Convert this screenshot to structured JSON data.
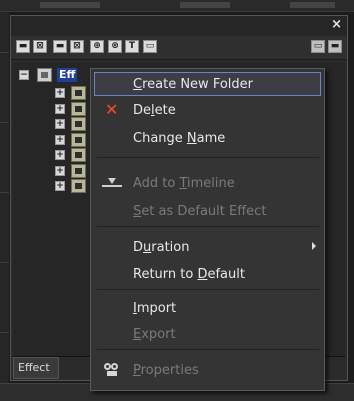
{
  "panel": {
    "close_glyph": "×",
    "toolbar_icons": [
      "new-folder-icon",
      "copy-icon",
      "paste-icon",
      "delete-icon",
      "expand-icon",
      "collapse-icon",
      "text-icon",
      "window-icon",
      "list-view-icon",
      "lock-icon"
    ],
    "toolbar_glyphs": [
      "▬",
      "⊠",
      "▬",
      "⊠",
      "⊕",
      "⊗",
      "T",
      "▭",
      "▭",
      "▬"
    ],
    "tree": {
      "root_label": "Eff",
      "expand_glyphs": {
        "collapsed": "+",
        "expanded": "−"
      },
      "child_icons": [
        "folder-icon",
        "folder-icon",
        "folder-icon",
        "folder-icon",
        "folder-icon",
        "title-folder-icon",
        "folder-icon"
      ]
    },
    "tab_label": "Effect"
  },
  "context_menu": {
    "items": [
      {
        "pre": "",
        "accel": "C",
        "post": "reate New Folder",
        "enabled": true,
        "highlighted": true,
        "icon": ""
      },
      {
        "pre": "De",
        "accel": "l",
        "post": "ete",
        "enabled": true,
        "highlighted": false,
        "icon": "delete-x-icon"
      },
      {
        "pre": "Change ",
        "accel": "N",
        "post": "ame",
        "enabled": true,
        "highlighted": false,
        "icon": ""
      },
      {
        "pre": "Add to ",
        "accel": "T",
        "post": "imeline",
        "enabled": false,
        "highlighted": false,
        "icon": "add-to-timeline-icon"
      },
      {
        "pre": "",
        "accel": "S",
        "post": "et as Default Effect",
        "enabled": false,
        "highlighted": false,
        "icon": ""
      },
      {
        "pre": "D",
        "accel": "u",
        "post": "ration",
        "enabled": true,
        "highlighted": false,
        "icon": "",
        "submenu": true
      },
      {
        "pre": "Return to ",
        "accel": "D",
        "post": "efault",
        "enabled": true,
        "highlighted": false,
        "icon": ""
      },
      {
        "pre": "",
        "accel": "I",
        "post": "mport",
        "enabled": true,
        "highlighted": false,
        "icon": ""
      },
      {
        "pre": "",
        "accel": "E",
        "post": "xport",
        "enabled": false,
        "highlighted": false,
        "icon": ""
      },
      {
        "pre": "",
        "accel": "P",
        "post": "roperties",
        "enabled": false,
        "highlighted": false,
        "icon": "properties-icon"
      }
    ]
  },
  "colors": {
    "selection": "#1f3f99",
    "delete_icon": "#ff4a1c",
    "menu_bg": "#343434",
    "highlight_border": "#6b86c8"
  }
}
